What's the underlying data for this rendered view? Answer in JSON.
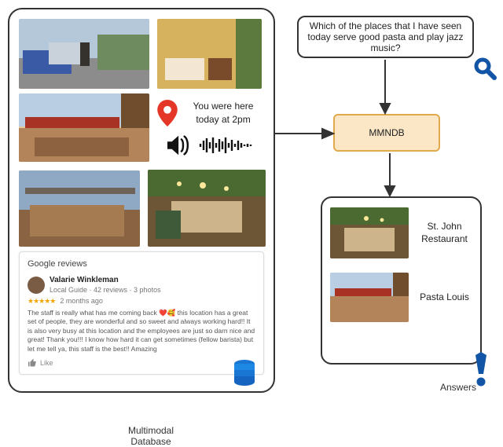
{
  "query": "Which of the places that I have seen today serve good pasta and play jazz music?",
  "processor_label": "MMNDB",
  "db_label": "Multimodal Database",
  "location_note": "You were here today at 2pm",
  "reviews": {
    "header": "Google reviews",
    "reviewer": "Valarie Winkleman",
    "badge": "Local Guide · 42 reviews · 3 photos",
    "rating": "★★★★★",
    "timestamp": "2 months ago",
    "body": "The staff is really what has me coming back ❤️🥰 this location has a great set of people, they are wonderful and so sweet and always working hard!! It is also very busy at this location and the employees are just so darn nice and great! Thank you!!! I know how hard it can get sometimes (fellow barista) but let me tell ya, this staff is the best!! Amazing",
    "like_label": "Like"
  },
  "answers_label": "Answers",
  "answers": [
    {
      "name": "St. John Restaurant"
    },
    {
      "name": "Pasta Louis"
    }
  ]
}
